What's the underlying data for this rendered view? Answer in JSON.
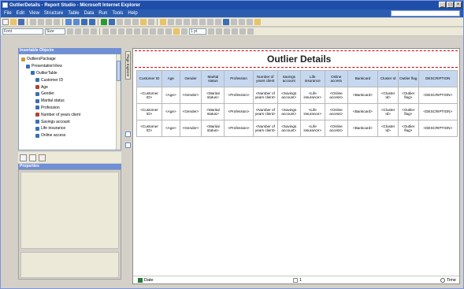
{
  "window": {
    "title": "OutlierDetails - Report Studio - Microsoft Internet Explorer",
    "controls": [
      "_",
      "□",
      "×"
    ]
  },
  "menubar": {
    "items": [
      "File",
      "Edit",
      "View",
      "Structure",
      "Table",
      "Data",
      "Run",
      "Tools",
      "Help"
    ]
  },
  "toolbar2": {
    "font_combo": "Font",
    "size_combo": "Size",
    "line_combo": "1 pt"
  },
  "insertable": {
    "header": "Insertable Objects",
    "tree": [
      {
        "label": "OutliersPackage",
        "indent": 0,
        "icon_color": "#c89a3a"
      },
      {
        "label": "PresentationView",
        "indent": 1,
        "icon_color": "#3a6fb8"
      },
      {
        "label": "OutlierTable",
        "indent": 2,
        "icon_color": "#3a6fb8"
      },
      {
        "label": "Customer ID",
        "indent": 3,
        "icon_color": "#3a6fb8"
      },
      {
        "label": "Age",
        "indent": 3,
        "icon_color": "#b84030"
      },
      {
        "label": "Gender",
        "indent": 3,
        "icon_color": "#3a6fb8"
      },
      {
        "label": "Marital status",
        "indent": 3,
        "icon_color": "#3a6fb8"
      },
      {
        "label": "Profession",
        "indent": 3,
        "icon_color": "#3a6fb8"
      },
      {
        "label": "Number of years client",
        "indent": 3,
        "icon_color": "#b84030"
      },
      {
        "label": "Savings account",
        "indent": 3,
        "icon_color": "#3a6fb8"
      },
      {
        "label": "Life insurance",
        "indent": 3,
        "icon_color": "#3a6fb8"
      },
      {
        "label": "Online access",
        "indent": 3,
        "icon_color": "#3a6fb8"
      }
    ]
  },
  "properties": {
    "header": "Properties"
  },
  "vstrip": {
    "tab_label": "Page Explorer"
  },
  "report": {
    "title": "Outlier Details",
    "columns": [
      "Customer ID",
      "Age",
      "Gender",
      "Marital status",
      "Profession",
      "Number of years client",
      "Savings account",
      "Life insurance",
      "Online access",
      "Bankcard",
      "Cluster Id",
      "Outlier flag",
      "DESCRIPTION"
    ],
    "rows": [
      [
        "<Customer ID>",
        "<Age>",
        "<Gender>",
        "<Marital status>",
        "<Profession>",
        "<Number of years client>",
        "<Savings account>",
        "<Life insurance>",
        "<Online access>",
        "<Bankcard>",
        "<Cluster Id>",
        "<Outlier flag>",
        "<DESCRIPTION>"
      ],
      [
        "<Customer ID>",
        "<Age>",
        "<Gender>",
        "<Marital status>",
        "<Profession>",
        "<Number of years client>",
        "<Savings account>",
        "<Life insurance>",
        "<Online access>",
        "<Bankcard>",
        "<Cluster Id>",
        "<Outlier flag>",
        "<DESCRIPTION>"
      ],
      [
        "<Customer ID>",
        "<Age>",
        "<Gender>",
        "<Marital status>",
        "<Profession>",
        "<Number of years client>",
        "<Savings account>",
        "<Life insurance>",
        "<Online access>",
        "<Bankcard>",
        "<Cluster Id>",
        "<Outlier flag>",
        "<DESCRIPTION>"
      ]
    ]
  },
  "footer": {
    "date": "Date",
    "page": "1",
    "time": "Time"
  },
  "colors": {
    "titlebar": "#1f4ea8",
    "header_fill": "#c6d8f0",
    "pane_header": "#6f8fd6"
  }
}
